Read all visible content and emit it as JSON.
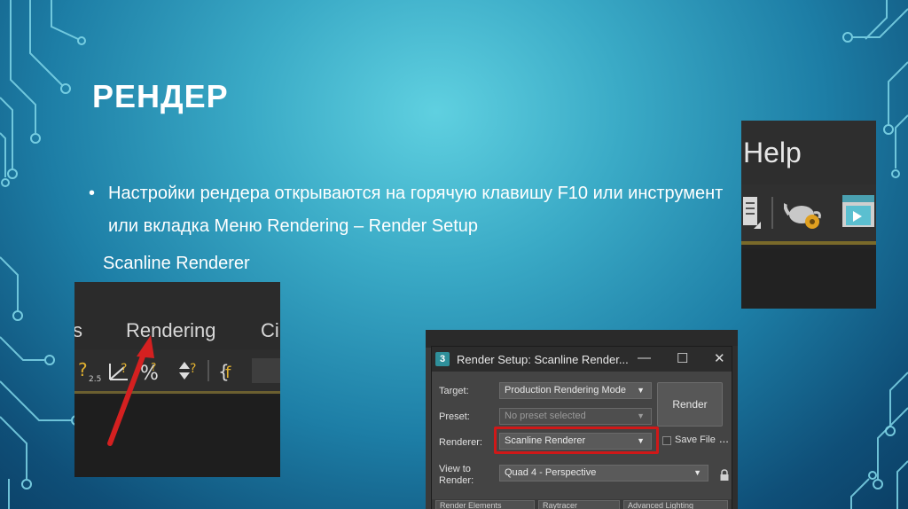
{
  "slide": {
    "title": "РЕНДЕР",
    "bullet_marker": "•",
    "bullet_text": "Настройки рендера открываются на горячую клавишу F10 или инструмент или вкладка Меню Rendering – Render Setup",
    "caption": "Scanline Renderer"
  },
  "left_screenshot": {
    "menu_items": [
      "s",
      "Rendering",
      "Ci"
    ]
  },
  "right_screenshot": {
    "menu_label": "Help"
  },
  "dialog": {
    "app_icon_label": "3",
    "title": "Render Setup: Scanline Render...",
    "min_button": "—",
    "max_button": "☐",
    "close_button": "✕",
    "target_label": "Target:",
    "target_value": "Production Rendering Mode",
    "preset_label": "Preset:",
    "preset_value": "No preset selected",
    "renderer_label": "Renderer:",
    "renderer_value": "Scanline Renderer",
    "save_file_label": "Save File",
    "more_button": "...",
    "view_label_1": "View to",
    "view_label_2": "Render:",
    "view_value": "Quad 4 - Perspective",
    "render_button": "Render",
    "dropdown_arrow": "▼",
    "tabs": [
      "Render Elements",
      "Raytracer",
      "Advanced Lighting"
    ]
  },
  "colors": {
    "highlight": "#d01818",
    "arrow": "#d42020",
    "circuit": "#7fd6e8"
  }
}
